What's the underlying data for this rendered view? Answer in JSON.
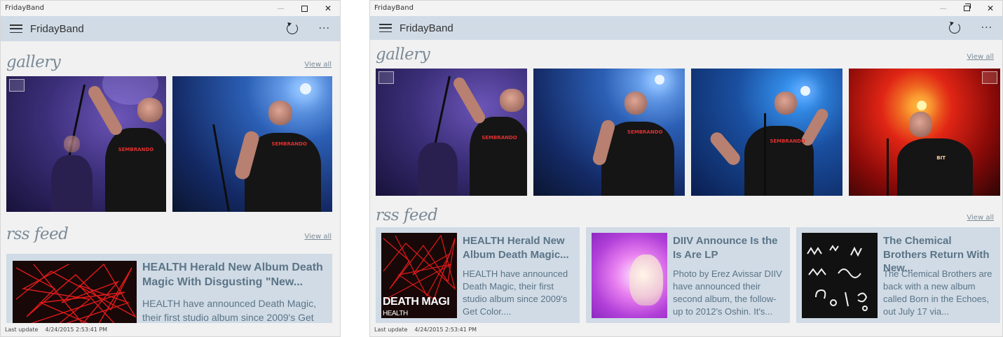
{
  "app": {
    "window_title": "FridayBand",
    "app_title": "FridayBand"
  },
  "sections": {
    "gallery_title": "gallery",
    "rss_title": "rss feed",
    "view_all": "View all"
  },
  "feed": [
    {
      "title": "HEALTH Herald New Album Death Magic With Disgusting \"New...",
      "title_short": "HEALTH Herald New Album Death Magic...",
      "body": "HEALTH have announced Death Magic, their first studio album since 2009's Get Color...",
      "body_short": "HEALTH have announced Death Magic, their first studio album since 2009's Get Color....",
      "thumb_text": "DEATH MAGI",
      "thumb_sub": "HEALTH"
    },
    {
      "title": "DIIV Announce Is the Is Are LP",
      "body": "Photo by Erez Avissar DIIV have announced their second album, the follow-up to 2012's Oshin. It's..."
    },
    {
      "title": "The Chemical Brothers Return With New...",
      "body": "The Chemical Brothers are back with a new album called Born in the Echoes, out July 17 via..."
    }
  ],
  "status": {
    "label": "Last update",
    "timestamp": "4/24/2015 2:53:41 PM"
  },
  "colors": {
    "appbar": "#d0dbe6",
    "section_title": "#7a8a97",
    "card_text": "#5b7486"
  },
  "icons": [
    "hamburger-icon",
    "refresh-icon",
    "more-icon",
    "minimize-icon",
    "maximize-icon",
    "restore-icon",
    "close-icon"
  ]
}
